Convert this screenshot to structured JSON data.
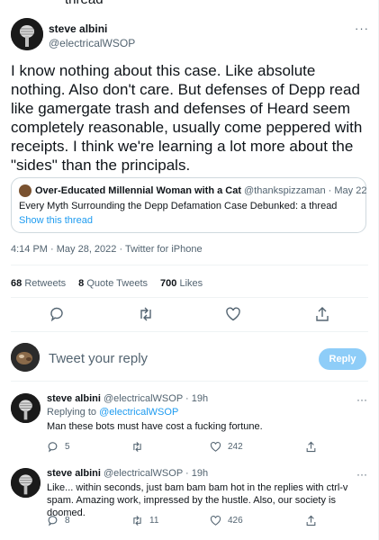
{
  "thread_fragment": "thread",
  "main_tweet": {
    "name": "steve albini",
    "handle": "@electricalWSOP",
    "more": "···",
    "text": "I know nothing about this case. Like absolute nothing. Also don't care. But defenses of Depp read like gamergate trash and defenses of Heard seem completely reasonable, usually come peppered with receipts. I think we're learning a lot more about the \"sides\" than the principals.",
    "quote": {
      "name": "Over-Educated Millennial Woman with a Cat",
      "handle": "@thankspizzaman",
      "date": "· May 22",
      "text": "Every Myth Surrounding the Depp Defamation Case Debunked: a thread",
      "show_thread": "Show this thread"
    },
    "timestamp": "4:14 PM · May 28, 2022 · Twitter for iPhone",
    "stats": {
      "retweets_count": "68",
      "retweets_label": "Retweets",
      "quote_count": "8",
      "quote_label": "Quote Tweets",
      "likes_count": "700",
      "likes_label": "Likes"
    },
    "icons": [
      "reply-icon",
      "retweet-icon",
      "like-icon",
      "share-icon"
    ]
  },
  "composer": {
    "placeholder": "Tweet your reply",
    "button": "Reply",
    "button_color": "#8ecdf8"
  },
  "replies": [
    {
      "name": "steve albini",
      "handle_time": "@electricalWSOP · 19h",
      "replying_to_label": "Replying to",
      "replying_to_handle": "@electricalWSOP",
      "text": "Man these bots must have cost a fucking fortune.",
      "reply_count": "5",
      "retweet_count": "",
      "like_count": "242"
    },
    {
      "name": "steve albini",
      "handle_time": "@electricalWSOP · 19h",
      "text": "Like... within seconds, just bam bam bam hot in the replies with ctrl-v spam. Amazing work, impressed by the hustle. Also, our society is doomed.",
      "reply_count": "8",
      "retweet_count": "11",
      "like_count": "426"
    }
  ],
  "colors": {
    "accent": "#1d9bf0",
    "text": "#0f1419",
    "secondary": "#536471",
    "border": "#cfd9de"
  }
}
